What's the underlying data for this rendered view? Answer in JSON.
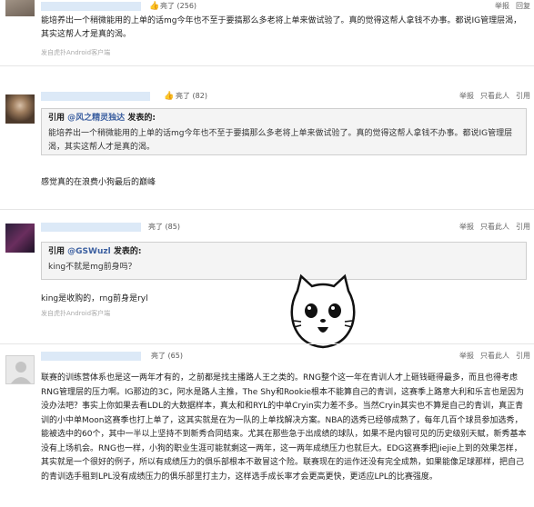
{
  "posts": [
    {
      "likes": "亮了 (256)",
      "actions": [
        "举报",
        "回复"
      ],
      "text": "能培养出一个稍微能用的上单的话mg今年也不至于要搞那么多老将上单来做试验了。真的觉得这帮人拿钱不办事。都说IG管理层渴，其实这帮人才是真的渴。",
      "meta": "发自虎扑Android客户端"
    },
    {
      "likes": "亮了 (82)",
      "actions": [
        "举报",
        "只看此人",
        "引用"
      ],
      "quote_prefix": "引用",
      "quote_user": "@风之精灵独达",
      "quote_suffix": "发表的:",
      "quote_text": "能培养出一个稍微能用的上单的话mg今年也不至于要搞那么多老将上单来做试验了。真的觉得这帮人拿钱不办事。都说IG管理层渴，其实这帮人才是真的渴。",
      "text": "感觉真的在浪费小狗最后的巅峰"
    },
    {
      "likes": "亮了 (85)",
      "actions": [
        "举报",
        "只看此人",
        "引用"
      ],
      "quote_prefix": "引用",
      "quote_user": "@GSWuzl",
      "quote_suffix": "发表的:",
      "quote_text": "king不就是mg前身吗？",
      "text": "king是收购的，rng前身是ryl",
      "meta": "发自虎扑Android客户端"
    },
    {
      "likes": "亮了 (65)",
      "actions": [
        "举报",
        "只看此人",
        "引用"
      ],
      "text": "联赛的训练营体系也是这一两年才有的，之前都是找主播路人王之类的。RNG整个这一年在青训人才上砸钱砸得最多，而且也得考虑RNG管理层的压力啊。IG那边的3C，阿水是路人主推，The Shy和Rookie根本不能算自己的青训，这赛季上路意大利和乐言也是因为没办法吧？事实上你如果去看LDL的大数据样本，真太和和RYL的中单Cryin实力差不多。当然Cryin其实也不算是自己的青训，真正青训的小中单Moon这赛季也打上单了，这其实就是在为一队的上单找解决方案。NBA的选秀已经够成熟了，每年几百个球员参加选秀，能被选中的60个，其中一半以上坚持不到新秀合同结束。尤其在那些急于出成绩的球队，如果不是内银可见的历史级别天赋，新秀基本没有上场机会。RNG也一样，小狗的职业生涯可能就剩这一两年，这一两年成绩压力也就巨大。EDG这赛季把Jiejie上到的效果怎样，其实就是一个很好的例子，所以有成绩压力的俱乐部根本不敢冒这个险。联赛现在的运作还没有完全成熟，如果能像足球那样，把自己的青训选手租到LPL没有成绩压力的俱乐部里打主力，这样选手成长率才会更高更快，更适应LPL的比赛强度。"
    }
  ],
  "colors": {
    "quote_user": "#3b5fa0",
    "quote_bg": "#f4f4f4",
    "name_blur": "#dce9f7"
  }
}
